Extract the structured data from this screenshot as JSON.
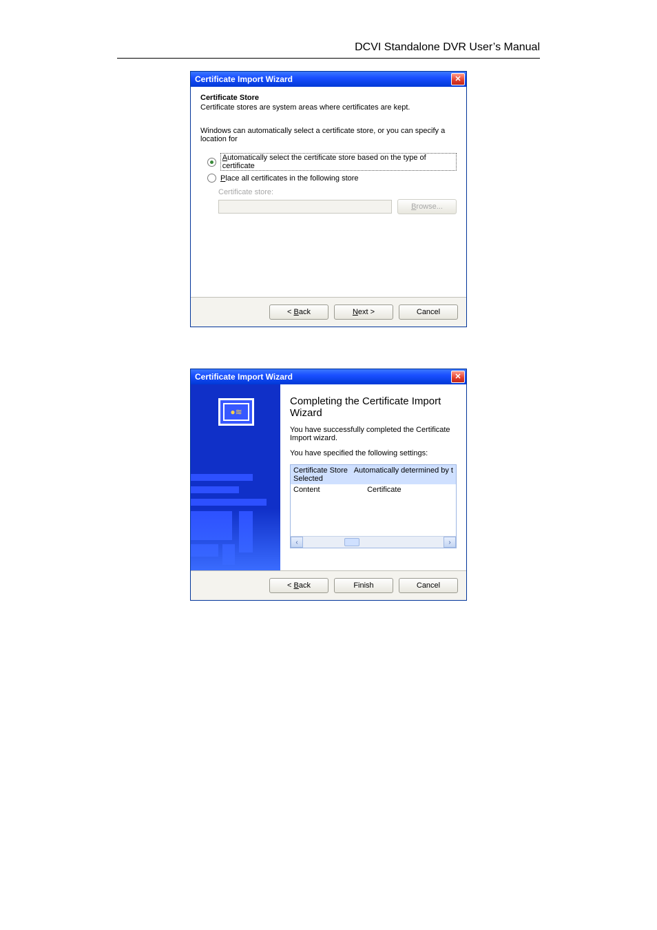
{
  "header": {
    "title": "DCVI Standalone DVR User’s Manual"
  },
  "dialog1": {
    "title": "Certificate Import Wizard",
    "section_title": "Certificate Store",
    "section_sub": "Certificate stores are system areas where certificates are kept.",
    "intro": "Windows can automatically select a certificate store, or you can specify a location for",
    "radio_auto_pre": "A",
    "radio_auto_rest": "utomatically select the certificate store based on the type of certificate",
    "radio_place_pre": "P",
    "radio_place_rest": "lace all certificates in the following store",
    "cert_store_label": "Certificate store:",
    "browse_pre": "B",
    "browse_rest": "rowse...",
    "back_pre": "< ",
    "back_u": "B",
    "back_rest": "ack",
    "next_u": "N",
    "next_rest": "ext >",
    "cancel": "Cancel"
  },
  "dialog2": {
    "title": "Certificate Import Wizard",
    "heading": "Completing the Certificate Import Wizard",
    "line1": "You have successfully completed the Certificate Import wizard.",
    "line2": "You have specified the following settings:",
    "row1_col1": "Certificate Store Selected",
    "row1_col2": "Automatically determined by t",
    "row2_col1": "Content",
    "row2_col2": "Certificate",
    "back_pre": "< ",
    "back_u": "B",
    "back_rest": "ack",
    "finish": "Finish",
    "cancel": "Cancel"
  }
}
